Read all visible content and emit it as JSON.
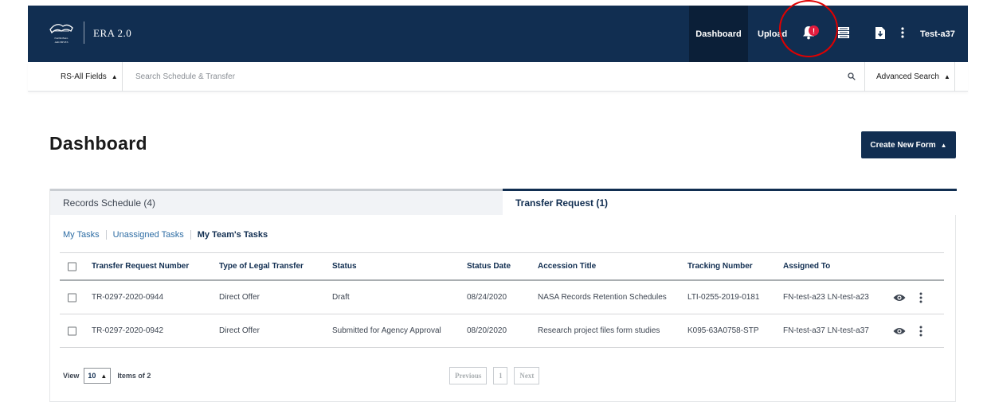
{
  "header": {
    "logo_text": "NATIONAL ARCHIVES",
    "app_name": "ERA 2.0",
    "nav": {
      "dashboard": "Dashboard",
      "upload": "Upload"
    },
    "notification_badge": "!",
    "user": "Test-a37",
    "icons": [
      "bell-icon",
      "list-icon",
      "download-file-icon",
      "more-vertical-icon"
    ]
  },
  "search": {
    "field_select": "RS-All Fields",
    "placeholder": "Search Schedule & Transfer",
    "advanced": "Advanced Search"
  },
  "page": {
    "title": "Dashboard",
    "create_button": "Create New Form"
  },
  "tabs": {
    "records_schedule": "Records Schedule (4)",
    "transfer_request": "Transfer Request (1)"
  },
  "subtabs": [
    "My Tasks",
    "Unassigned Tasks",
    "My Team's Tasks"
  ],
  "table": {
    "columns": [
      "Transfer Request Number",
      "Type of Legal Transfer",
      "Status",
      "Status Date",
      "Accession Title",
      "Tracking Number",
      "Assigned To"
    ],
    "rows": [
      [
        "TR-0297-2020-0944",
        "Direct Offer",
        "Draft",
        "08/24/2020",
        "NASA Records Retention Schedules",
        "LTI-0255-2019-0181",
        "FN-test-a23 LN-test-a23"
      ],
      [
        "TR-0297-2020-0942",
        "Direct Offer",
        "Submitted for Agency Approval",
        "08/20/2020",
        "Research project files form studies",
        "K095-63A0758-STP",
        "FN-test-a37 LN-test-a37"
      ]
    ]
  },
  "footer": {
    "view_label": "View",
    "page_size": "10",
    "items_of": "Items of 2",
    "previous": "Previous",
    "page_number": "1",
    "next": "Next"
  },
  "colors": {
    "nav_bg": "#112e51",
    "nav_active_bg": "#0b1f38",
    "badge": "#e31c3d",
    "highlight_ring": "#e00000",
    "link": "#2e6da4"
  }
}
